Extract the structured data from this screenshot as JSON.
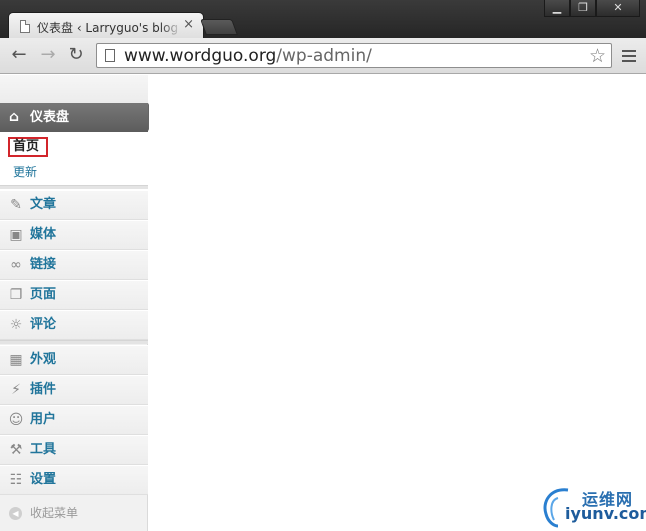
{
  "browser": {
    "tab_title": "仪表盘 ‹ Larryguo's blog",
    "tab_close": "×",
    "url_host": "www.wordguo.org",
    "url_path": "/wp-admin/"
  },
  "window_controls": {
    "minimize": "▁",
    "maximize": "❐",
    "close": "✕"
  },
  "sidebar": {
    "current": {
      "label": "仪表盘",
      "icon": "home-icon"
    },
    "submenu": [
      {
        "label": "首页",
        "current": true
      },
      {
        "label": "更新"
      }
    ],
    "groups": [
      [
        {
          "label": "文章",
          "icon": "pushpin-icon"
        },
        {
          "label": "媒体",
          "icon": "media-icon"
        },
        {
          "label": "链接",
          "icon": "link-icon"
        },
        {
          "label": "页面",
          "icon": "page-icon"
        },
        {
          "label": "评论",
          "icon": "comment-icon"
        }
      ],
      [
        {
          "label": "外观",
          "icon": "appearance-icon"
        },
        {
          "label": "插件",
          "icon": "plugin-icon"
        },
        {
          "label": "用户",
          "icon": "users-icon"
        },
        {
          "label": "工具",
          "icon": "tools-icon"
        },
        {
          "label": "设置",
          "icon": "settings-icon"
        }
      ]
    ],
    "collapse_label": "收起菜单"
  },
  "watermark": {
    "cn": "运维网",
    "en": "iyunv.com"
  },
  "colors": {
    "link": "#21759b",
    "highlight_border": "#d2252b",
    "current_bg": "#666666"
  }
}
